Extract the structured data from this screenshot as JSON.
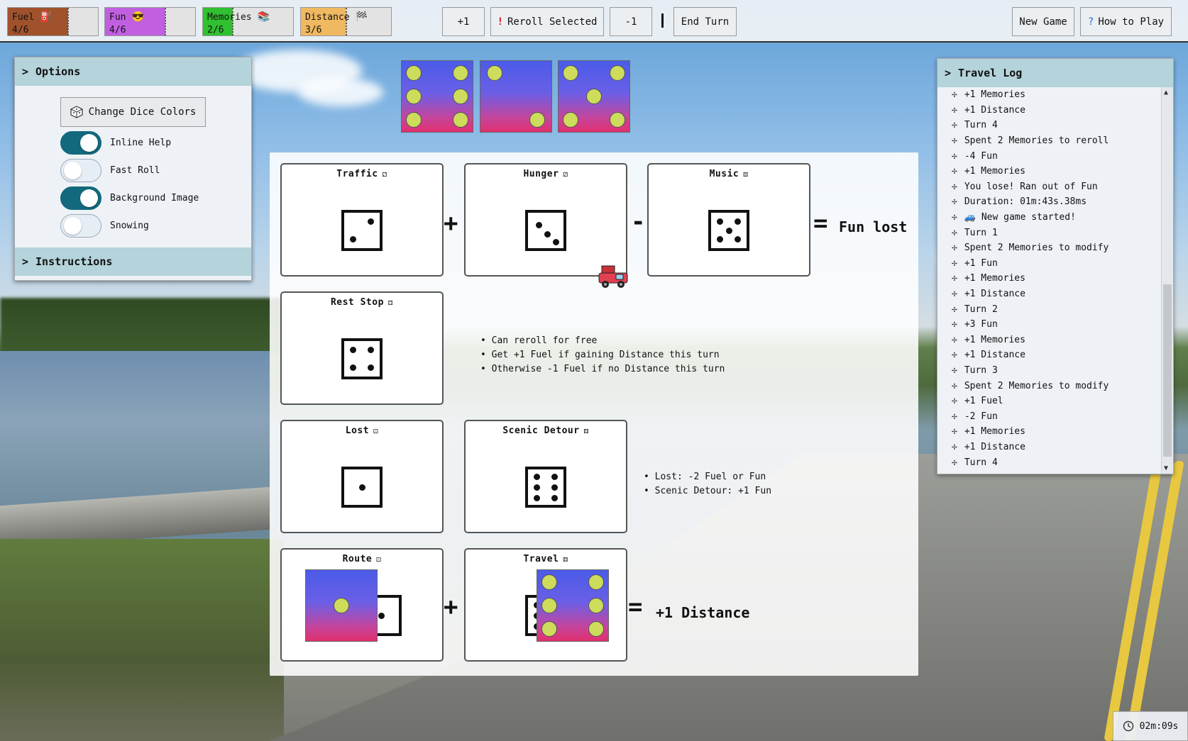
{
  "stats": [
    {
      "name": "Fuel",
      "value": "4/6",
      "icon": "⛽",
      "color": "#a0522d",
      "fraction": 0.6667
    },
    {
      "name": "Fun",
      "value": "4/6",
      "icon": "😎",
      "color": "#c060e0",
      "fraction": 0.6667
    },
    {
      "name": "Memories",
      "value": "2/6",
      "icon": "📚",
      "color": "#30c030",
      "fraction": 0.3333
    },
    {
      "name": "Distance",
      "value": "3/6",
      "icon": "🏁",
      "color": "#f0b860",
      "fraction": 0.5
    }
  ],
  "toolbar": {
    "plus_one": "+1",
    "reroll_icon": "!",
    "reroll": "Reroll Selected",
    "minus_one": "-1",
    "end_turn": "End Turn",
    "new_game": "New Game",
    "how_icon": "?",
    "how_to_play": "How to Play"
  },
  "options": {
    "title": "Options",
    "change_dice_colors": "Change Dice Colors",
    "toggles": [
      {
        "label": "Inline Help",
        "on": true
      },
      {
        "label": "Fast Roll",
        "on": false
      },
      {
        "label": "Background Image",
        "on": true
      },
      {
        "label": "Snowing",
        "on": false
      }
    ],
    "instructions": "Instructions"
  },
  "tray_dice": [
    6,
    2,
    5
  ],
  "board": {
    "traffic": {
      "title": "Traffic",
      "face": 2
    },
    "hunger": {
      "title": "Hunger",
      "face": 3
    },
    "music": {
      "title": "Music",
      "face": 5
    },
    "rest_stop": {
      "title": "Rest Stop",
      "face": 4
    },
    "lost": {
      "title": "Lost",
      "face": 1
    },
    "scenic_detour": {
      "title": "Scenic Detour",
      "face": 6
    },
    "route": {
      "title": "Route",
      "face": 1
    },
    "travel": {
      "title": "Travel",
      "face": 6
    },
    "op_plus": "+",
    "op_minus": "-",
    "op_eq": "=",
    "fun_result": "Fun lost",
    "distance_result": "+1 Distance",
    "rest_notes": [
      "Can reroll for free",
      "Get +1 Fuel if gaining Distance this turn",
      "Otherwise -1 Fuel if no Distance this turn"
    ],
    "detour_notes": [
      "Lost: -2 Fuel or Fun",
      "Scenic Detour: +1 Fun"
    ]
  },
  "log": {
    "title": "Travel Log",
    "items": [
      "+1 Memories",
      "+1 Distance",
      "Turn 4",
      "Spent 2 Memories to reroll",
      "-4 Fun",
      "+1 Memories",
      "You lose! Ran out of Fun",
      "Duration: 01m:43s.38ms",
      "🚙 New game started!",
      "Turn 1",
      "Spent 2 Memories to modify",
      "+1 Fun",
      "+1 Memories",
      "+1 Distance",
      "Turn 2",
      "+3 Fun",
      "+1 Memories",
      "+1 Distance",
      "Turn 3",
      "Spent 2 Memories to modify",
      "+1 Fuel",
      "-2 Fun",
      "+1 Memories",
      "+1 Distance",
      "Turn 4"
    ]
  },
  "timer": "02m:09s"
}
